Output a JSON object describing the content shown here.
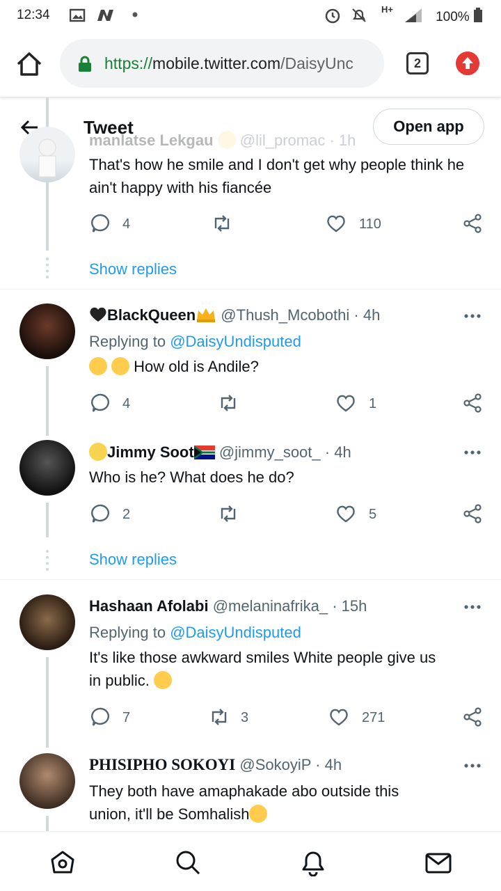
{
  "status_bar": {
    "time": "12:34",
    "network": "H+",
    "battery": "100%"
  },
  "browser": {
    "url_scheme": "https://",
    "url_host": "mobile.twitter.com",
    "url_path": "/DaisyUnc",
    "tab_count": "2"
  },
  "header": {
    "title": "Tweet",
    "open_app_label": "Open app"
  },
  "tweets": [
    {
      "name": "manlatse Lekgau",
      "handle": "@lil_promac",
      "time": "· 1h",
      "text": "That's how he smile and I don't get why people think he ain't happy with his fiancée",
      "replies": "4",
      "retweets": "",
      "likes": "110",
      "show_replies": "Show replies"
    },
    {
      "name": "BlackQueen",
      "handle": "@Thush_Mcobothi",
      "time": "· 4h",
      "replying_prefix": "Replying to ",
      "replying_to": "@DaisyUndisputed",
      "text": "How old is Andile?",
      "replies": "4",
      "retweets": "",
      "likes": "1"
    },
    {
      "name": "Jimmy Soot",
      "handle": "@jimmy_soot_",
      "time": "· 4h",
      "text": "Who is he? What does he do?",
      "replies": "2",
      "retweets": "",
      "likes": "5",
      "show_replies": "Show replies"
    },
    {
      "name": "Hashaan Afolabi",
      "handle": "@melaninafrika_",
      "time": "· 15h",
      "replying_prefix": "Replying to ",
      "replying_to": "@DaisyUndisputed",
      "text_line1": "It's like those awkward smiles White people give us",
      "text_line2": "in public.",
      "replies": "7",
      "retweets": "3",
      "likes": "271"
    },
    {
      "name": "PHISIPHO SOKOYI",
      "handle": "@SokoyiP",
      "time": "· 4h",
      "text_line1": "They both have amaphakade abo outside this",
      "text_line2": "union, it'll be Somhalish"
    }
  ],
  "colors": {
    "link": "#1d9bf0",
    "secondary_text": "#536471",
    "primary_text": "#0f1419",
    "divider": "#eff3f4"
  }
}
